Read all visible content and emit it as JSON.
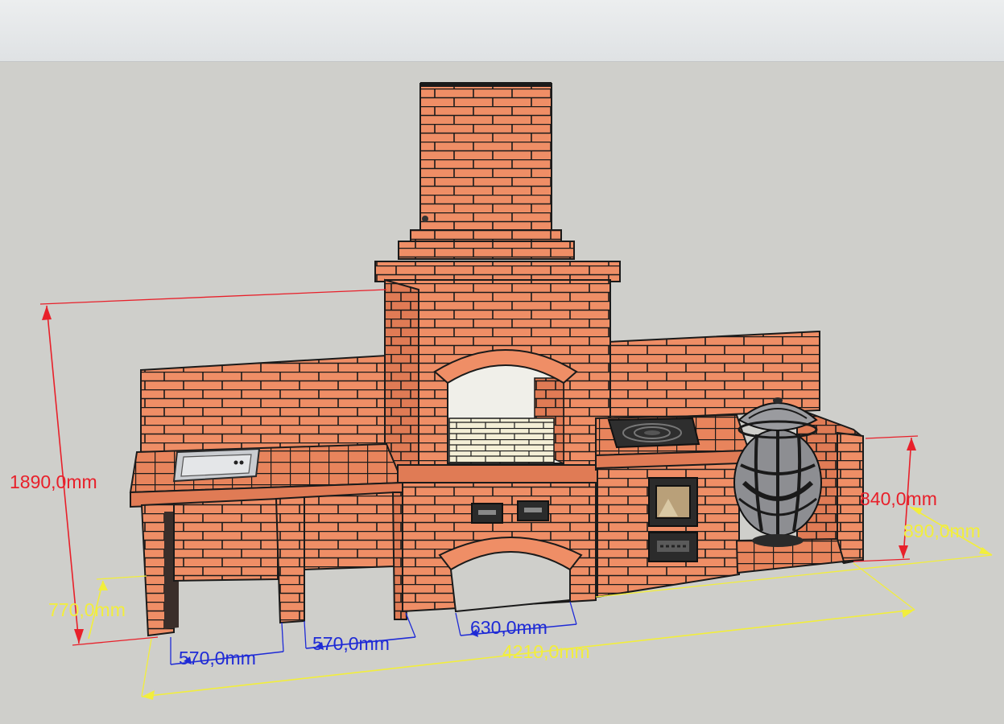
{
  "dimensions": {
    "total_height": "1890,0mm",
    "counter_height": "770,0mm",
    "right_wall_height": "840,0mm",
    "right_depth": "890,0mm",
    "total_length": "4210,0mm",
    "bay_left": "570,0mm",
    "bay_middle": "570,0mm",
    "firebox_opening": "630,0mm"
  },
  "colors": {
    "brick": "#ef8e66",
    "mortar": "#1a1a1a",
    "background": "#cfcfcb",
    "dimension_red": "#e8202a",
    "dimension_yellow": "#f2ee3c",
    "dimension_blue": "#1f2bd6"
  },
  "components": [
    "chimney",
    "grill-hearth",
    "sink",
    "cooktop",
    "oven-door",
    "ash-door",
    "tandoor",
    "counter-wall-left",
    "counter-wall-right"
  ]
}
